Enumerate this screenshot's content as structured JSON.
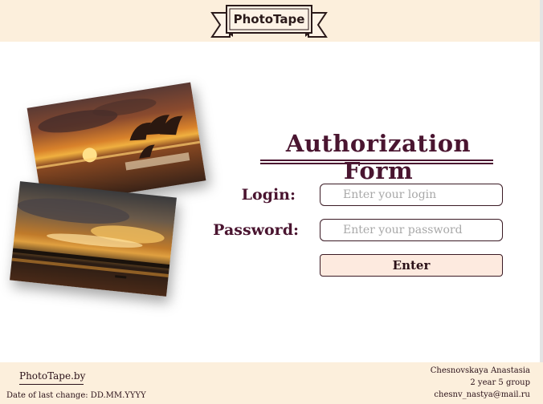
{
  "header": {
    "logo_text": "PhotoTape"
  },
  "photos": [
    {
      "name": "dolphins-sunset-photo"
    },
    {
      "name": "sea-sunset-photo"
    }
  ],
  "form": {
    "title": "Authorization Form",
    "login_label": "Login:",
    "login_placeholder": "Enter your login",
    "login_value": "",
    "password_label": "Password:",
    "password_placeholder": "Enter your password",
    "password_value": "",
    "enter_label": "Enter"
  },
  "footer": {
    "site_link": "PhotoTape.by",
    "last_change": "Date of last change: DD.MM.YYYY",
    "author_name": "Chesnovskaya Anastasia",
    "author_group": "2 year 5 group",
    "author_email": "chesnv_nastya@mail.ru"
  },
  "colors": {
    "header_bg": "#fcefdc",
    "accent_text": "#4a1530",
    "button_bg": "#fdeadf"
  }
}
